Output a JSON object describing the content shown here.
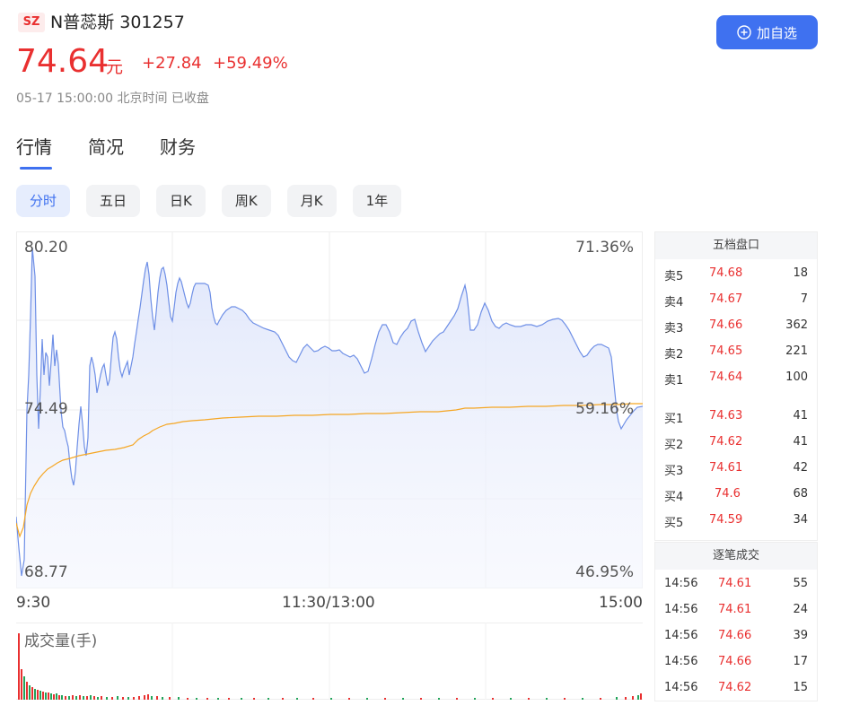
{
  "stock": {
    "market": "SZ",
    "name": "N普蕊斯 301257",
    "price": "74.64",
    "unit": "元",
    "change": "+27.84",
    "change_pct": "+59.49%",
    "time_status": "05-17 15:00:00 北京时间 已收盘",
    "add_label": "加自选"
  },
  "tabs": [
    "行情",
    "简况",
    "财务"
  ],
  "periods": [
    "分时",
    "五日",
    "日K",
    "周K",
    "月K",
    "1年"
  ],
  "chart": {
    "y_top": "80.20",
    "y_mid": "74.49",
    "y_bot": "68.77",
    "pct_top": "71.36%",
    "pct_mid": "59.16%",
    "pct_bot": "46.95%",
    "x_start": "9:30",
    "x_mid": "11:30/13:00",
    "x_end": "15:00",
    "volume_title": "成交量(手)"
  },
  "colors": {
    "price_line": "#6e8fe6",
    "avg_line": "#f5a623",
    "up": "#e93030",
    "down": "#22a45a",
    "accent": "#3f71f0"
  },
  "order_book": {
    "title": "五档盘口",
    "asks": [
      {
        "label": "卖5",
        "price": "74.68",
        "vol": "18"
      },
      {
        "label": "卖4",
        "price": "74.67",
        "vol": "7"
      },
      {
        "label": "卖3",
        "price": "74.66",
        "vol": "362"
      },
      {
        "label": "卖2",
        "price": "74.65",
        "vol": "221"
      },
      {
        "label": "卖1",
        "price": "74.64",
        "vol": "100"
      }
    ],
    "bids": [
      {
        "label": "买1",
        "price": "74.63",
        "vol": "41"
      },
      {
        "label": "买2",
        "price": "74.62",
        "vol": "41"
      },
      {
        "label": "买3",
        "price": "74.61",
        "vol": "42"
      },
      {
        "label": "买4",
        "price": "74.6",
        "vol": "68"
      },
      {
        "label": "买5",
        "price": "74.59",
        "vol": "34"
      }
    ]
  },
  "trades": {
    "title": "逐笔成交",
    "rows": [
      {
        "time": "14:56",
        "price": "74.61",
        "vol": "55"
      },
      {
        "time": "14:56",
        "price": "74.61",
        "vol": "24"
      },
      {
        "time": "14:56",
        "price": "74.66",
        "vol": "39"
      },
      {
        "time": "14:56",
        "price": "74.66",
        "vol": "17"
      },
      {
        "time": "14:56",
        "price": "74.62",
        "vol": "15"
      }
    ]
  }
}
